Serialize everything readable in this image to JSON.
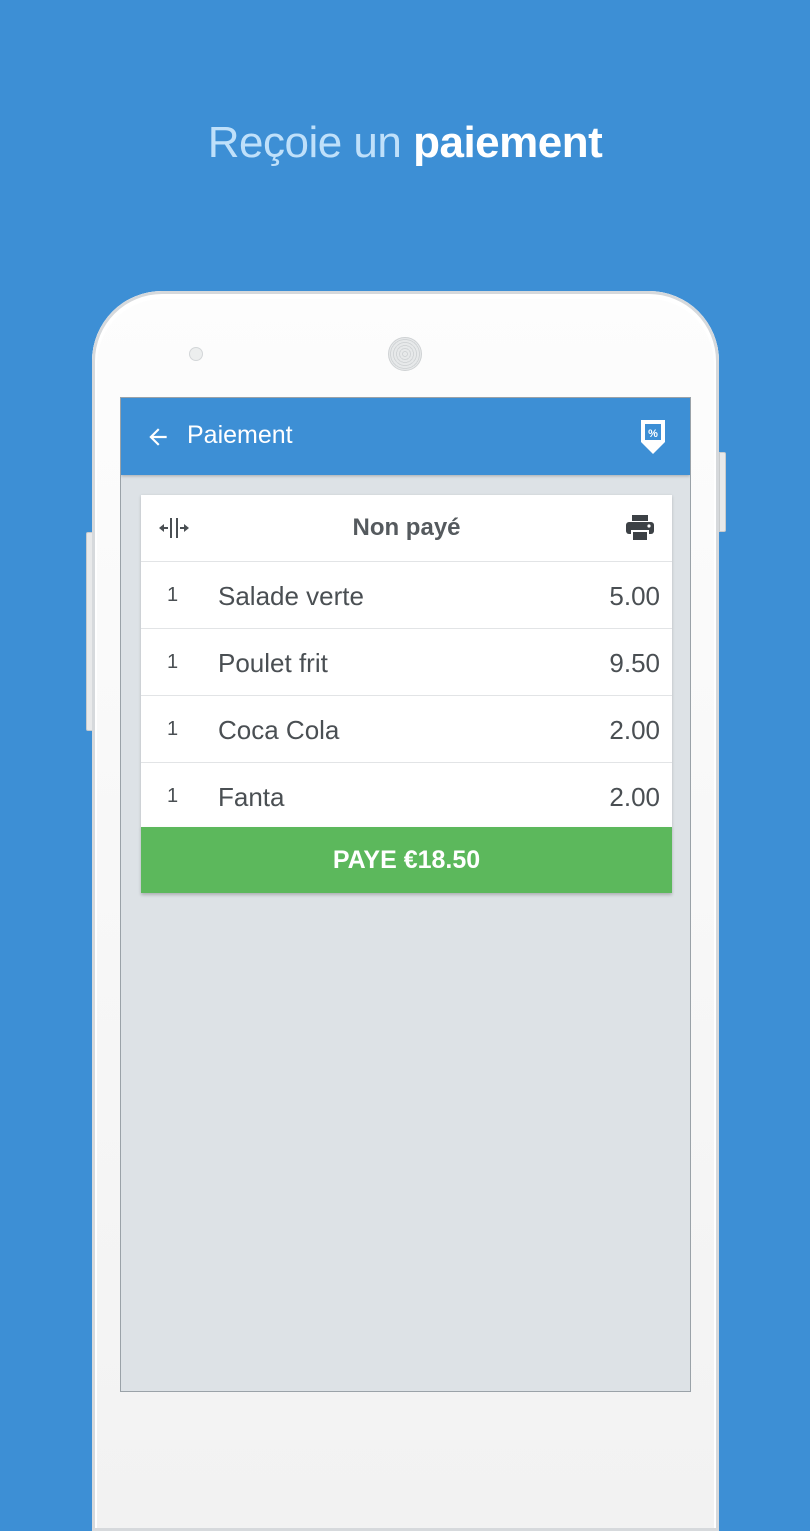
{
  "headline": {
    "part1": "Reçoie un ",
    "part2": "paiement"
  },
  "appbar": {
    "title": "Paiement",
    "back_icon": "arrow-left-icon",
    "action_icon": "discount-percent-icon"
  },
  "bill": {
    "status_title": "Non payé",
    "split_icon": "split-icon",
    "print_icon": "print-icon",
    "items": [
      {
        "qty": "1",
        "name": "Salade verte",
        "price": "5.00"
      },
      {
        "qty": "1",
        "name": "Poulet frit",
        "price": "9.50"
      },
      {
        "qty": "1",
        "name": "Coca Cola",
        "price": "2.00"
      },
      {
        "qty": "1",
        "name": "Fanta",
        "price": "2.00"
      }
    ],
    "pay_label": "PAYE €18.50"
  },
  "colors": {
    "background": "#3d8fd5",
    "appbar": "#3d8fd5",
    "pay_button": "#5cb85c",
    "screen_background": "#dde2e6"
  }
}
